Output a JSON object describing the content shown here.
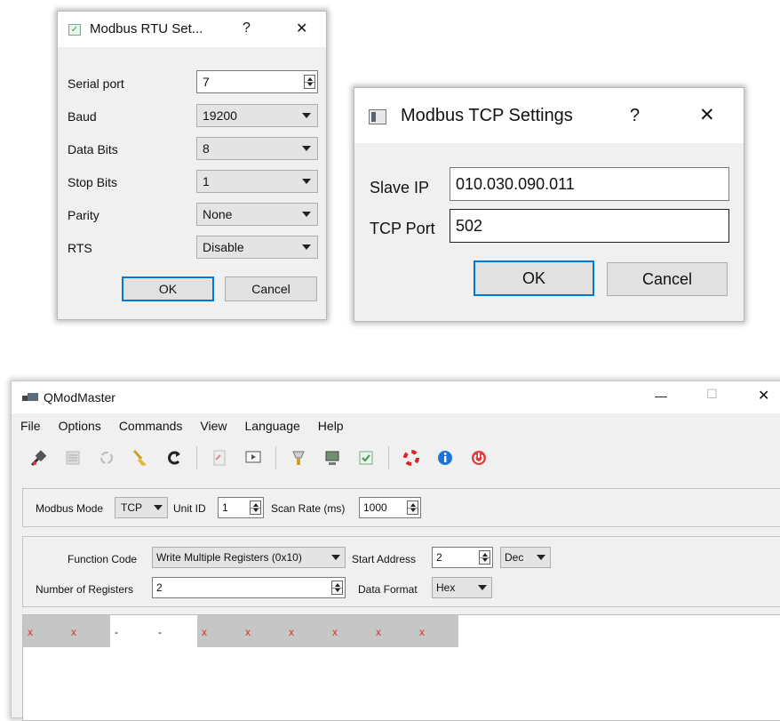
{
  "rtu": {
    "title": "Modbus RTU Set...",
    "help": "?",
    "close": "✕",
    "fields": {
      "serial_port": {
        "label": "Serial port",
        "value": "7"
      },
      "baud": {
        "label": "Baud",
        "value": "19200"
      },
      "data_bits": {
        "label": "Data Bits",
        "value": "8"
      },
      "stop_bits": {
        "label": "Stop Bits",
        "value": "1"
      },
      "parity": {
        "label": "Parity",
        "value": "None"
      },
      "rts": {
        "label": "RTS",
        "value": "Disable"
      }
    },
    "ok": "OK",
    "cancel": "Cancel"
  },
  "tcp": {
    "title": "Modbus TCP Settings",
    "help": "?",
    "close": "✕",
    "slave_ip": {
      "label": "Slave IP",
      "value": "010.030.090.011"
    },
    "tcp_port": {
      "label": "TCP Port",
      "value": "502"
    },
    "ok": "OK",
    "cancel": "Cancel"
  },
  "app": {
    "title": "QModMaster",
    "minimize": "—",
    "maximize": "☐",
    "close": "✕",
    "menu": {
      "file": "File",
      "options": "Options",
      "commands": "Commands",
      "view": "View",
      "language": "Language",
      "help": "Help"
    },
    "mode": {
      "modbus_mode_label": "Modbus Mode",
      "modbus_mode": "TCP",
      "unit_id_label": "Unit ID",
      "unit_id": "1",
      "scan_rate_label": "Scan Rate (ms)",
      "scan_rate": "1000"
    },
    "function": {
      "function_code_label": "Function Code",
      "function_code": "Write Multiple Registers (0x10)",
      "start_address_label": "Start Address",
      "start_address": "2",
      "address_format": "Dec",
      "num_registers_label": "Number of Registers",
      "num_registers": "2",
      "data_format_label": "Data Format",
      "data_format": "Hex"
    },
    "registers": [
      {
        "value": "x",
        "state": "error"
      },
      {
        "value": "x",
        "state": "error"
      },
      {
        "value": "-",
        "state": "ok"
      },
      {
        "value": "-",
        "state": "ok"
      },
      {
        "value": "x",
        "state": "error"
      },
      {
        "value": "x",
        "state": "error"
      },
      {
        "value": "x",
        "state": "error"
      },
      {
        "value": "x",
        "state": "error"
      },
      {
        "value": "x",
        "state": "error"
      },
      {
        "value": "x",
        "state": "error"
      }
    ]
  },
  "colors": {
    "accent": "#0078d7",
    "error_text": "#e03030",
    "error_cell": "#c6c6c6"
  }
}
